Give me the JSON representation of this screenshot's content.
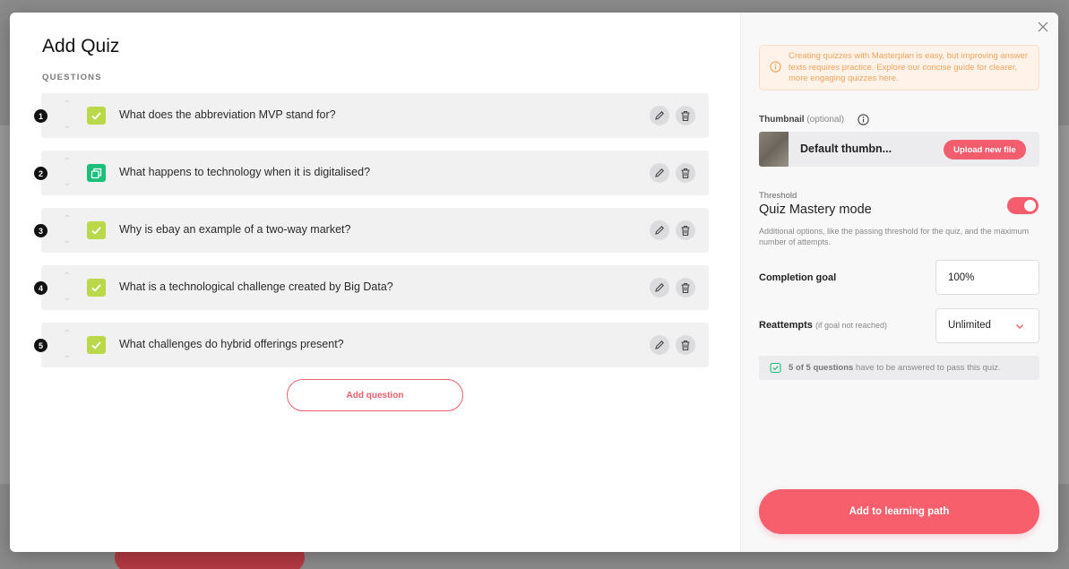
{
  "modal": {
    "title": "Add Quiz",
    "questions_label": "QUESTIONS",
    "add_question_label": "Add question"
  },
  "questions": [
    {
      "number": "1",
      "type": "single-choice",
      "icon": "check-icon",
      "text": "What does the abbreviation MVP stand for?"
    },
    {
      "number": "2",
      "type": "multiple-choice",
      "icon": "copy-icon",
      "text": "What happens to technology when it is digitalised?"
    },
    {
      "number": "3",
      "type": "single-choice",
      "icon": "check-icon",
      "text": "Why is ebay an example of a two-way market?"
    },
    {
      "number": "4",
      "type": "single-choice",
      "icon": "check-icon",
      "text": "What is a technological challenge created by Big Data?"
    },
    {
      "number": "5",
      "type": "single-choice",
      "icon": "check-icon",
      "text": "What challenges do hybrid offerings present?"
    }
  ],
  "sidebar": {
    "info_text": "Creating quizzes with Masterplan is easy, but improving answer texts requires practice. Explore our concise guide for clearer, more engaging quizzes here.",
    "thumbnail_label": "Thumbnail",
    "thumbnail_optional": "(optional)",
    "thumbnail_name": "Default thumbn...",
    "upload_label": "Upload new file",
    "threshold_label": "Threshold",
    "mastery_title": "Quiz Mastery mode",
    "mastery_enabled": true,
    "mastery_description": "Additional options, like the passing threshold for the quiz, and the maximum number of attempts.",
    "completion_label": "Completion goal",
    "completion_value": "100%",
    "reattempts_label": "Reattempts",
    "reattempts_sub": "(if goal not reached)",
    "reattempts_value": "Unlimited",
    "pass_count": "5 of 5 questions",
    "pass_rest": " have to be answered to pass this quiz.",
    "cta_label": "Add to learning path"
  },
  "colors": {
    "accent": "#f45d6d",
    "check_green": "#b9d94a",
    "multi_green": "#1bbf7a",
    "info_orange": "#f2a35c"
  }
}
